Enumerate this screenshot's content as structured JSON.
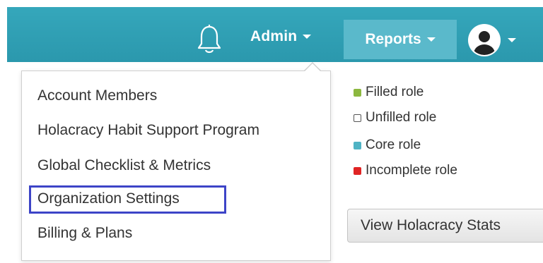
{
  "topbar": {
    "admin_label": "Admin",
    "reports_label": "Reports",
    "colors": {
      "bar": "#2f9fb4",
      "reports_bg": "#5ab9cb"
    }
  },
  "dropdown": {
    "items": [
      {
        "label": "Account Members"
      },
      {
        "label": "Holacracy Habit Support Program"
      },
      {
        "label": "Global Checklist & Metrics"
      },
      {
        "label": "Organization Settings",
        "highlighted": true
      },
      {
        "label": "Billing & Plans"
      }
    ],
    "highlight_color": "#3d44c7"
  },
  "legend": {
    "items": [
      {
        "label": "Filled role",
        "color": "#8cb83f"
      },
      {
        "label": "Unfilled role",
        "color": "#ffffff"
      },
      {
        "label": "Core role",
        "color": "#4fb3c4"
      },
      {
        "label": "Incomplete role",
        "color": "#e02424"
      }
    ]
  },
  "stats_button": {
    "label": "View Holacracy Stats"
  },
  "icons": {
    "bell": "bell-icon",
    "admin_caret": "chevron-down-icon",
    "reports_caret": "chevron-down-icon",
    "avatar": "user-avatar-icon",
    "avatar_caret": "chevron-down-icon"
  }
}
